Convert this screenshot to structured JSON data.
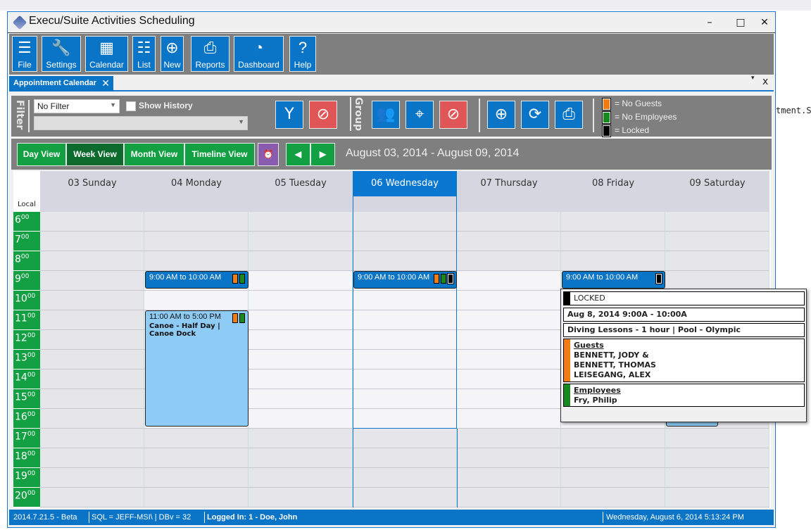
{
  "window": {
    "title": "Execu/Suite Activities Scheduling",
    "minimize": "–",
    "maximize": "□",
    "close": "✕"
  },
  "background_code": "tment.St",
  "toolbar": [
    {
      "label": "File",
      "icon": "file-cabinet-icon",
      "glyph": "☰"
    },
    {
      "label": "Settings",
      "icon": "wrench-icon",
      "glyph": "🔧"
    },
    {
      "label": "Calendar",
      "icon": "calendar-icon",
      "glyph": "▦"
    },
    {
      "label": "List",
      "icon": "list-icon",
      "glyph": "☷"
    },
    {
      "label": "New",
      "icon": "plus-circle-icon",
      "glyph": "⊕"
    },
    {
      "label": "Reports",
      "icon": "printer-icon",
      "glyph": "⎙"
    },
    {
      "label": "Dashboard",
      "icon": "gauge-icon",
      "glyph": "◔"
    },
    {
      "label": "Help",
      "icon": "help-icon",
      "glyph": "?"
    }
  ],
  "tab": {
    "label": "Appointment Calendar",
    "close": "✕",
    "menu": "▾",
    "panel_close": "x"
  },
  "filter": {
    "label": "Filter",
    "select_value": "No Filter",
    "show_history_label": "Show History",
    "show_history_checked": false,
    "secondary_value": ""
  },
  "group": {
    "label": "Group"
  },
  "legend": [
    {
      "text": "= No Guests",
      "color": "#ef7c14"
    },
    {
      "text": "= No Employees",
      "color": "#178a1e"
    },
    {
      "text": "= Locked",
      "color": "#000000"
    }
  ],
  "views": {
    "items": [
      "Day View",
      "Week View",
      "Month View",
      "Timeline View"
    ],
    "active": "Week View",
    "date_range": "August 03, 2014  -  August 09, 2014"
  },
  "calendar": {
    "timezone_label": "Local",
    "days": [
      "03 Sunday",
      "04 Monday",
      "05 Tuesday",
      "06 Wednesday",
      "07 Thursday",
      "08 Friday",
      "09 Saturday"
    ],
    "today_index": 3,
    "hours": [
      "6",
      "7",
      "8",
      "9",
      "10",
      "11",
      "12",
      "13",
      "14",
      "15",
      "16",
      "17",
      "18",
      "19",
      "20"
    ],
    "minutes": "00",
    "events": [
      {
        "day": 1,
        "start": 9,
        "end": 10,
        "style": "dark",
        "time": "9:00 AM to 10:00 AM",
        "title": "",
        "flags": [
          "o",
          "g"
        ]
      },
      {
        "day": 1,
        "start": 11,
        "end": 17,
        "style": "light",
        "time": "11:00 AM to 5:00 PM",
        "title": "Canoe - Half Day | Canoe Dock",
        "flags": [
          "o",
          "g"
        ]
      },
      {
        "day": 3,
        "start": 9,
        "end": 10,
        "style": "dark",
        "time": "9:00 AM to 10:00 AM",
        "title": "",
        "flags": [
          "o",
          "g",
          "k"
        ]
      },
      {
        "day": 5,
        "start": 9,
        "end": 10,
        "style": "dark",
        "time": "9:00 AM to 10:00 AM",
        "title": "",
        "flags": [
          "k"
        ]
      },
      {
        "day": 6,
        "start": 11,
        "end": 17,
        "style": "light",
        "time": "",
        "title": "",
        "flags": []
      }
    ]
  },
  "popup": {
    "locked": "LOCKED",
    "datetime": "Aug 8, 2014 9:00A - 10:00A",
    "activity": "Diving Lessons - 1 hour | Pool - Olympic",
    "guests_label": "Guests",
    "guests": [
      "BENNETT, JODY &",
      "BENNETT, THOMAS",
      "LEISEGANG, ALEX"
    ],
    "employees_label": "Employees",
    "employees": [
      "Fry, Philip"
    ]
  },
  "status": {
    "version": "2014.7.21.5 - Beta",
    "sql": "SQL = JEFF-MSI\\  |  DBv = 32",
    "user": "Logged In: 1 - Doe, John",
    "datetime": "Wednesday, August 6, 2014  5:13:24 PM"
  }
}
